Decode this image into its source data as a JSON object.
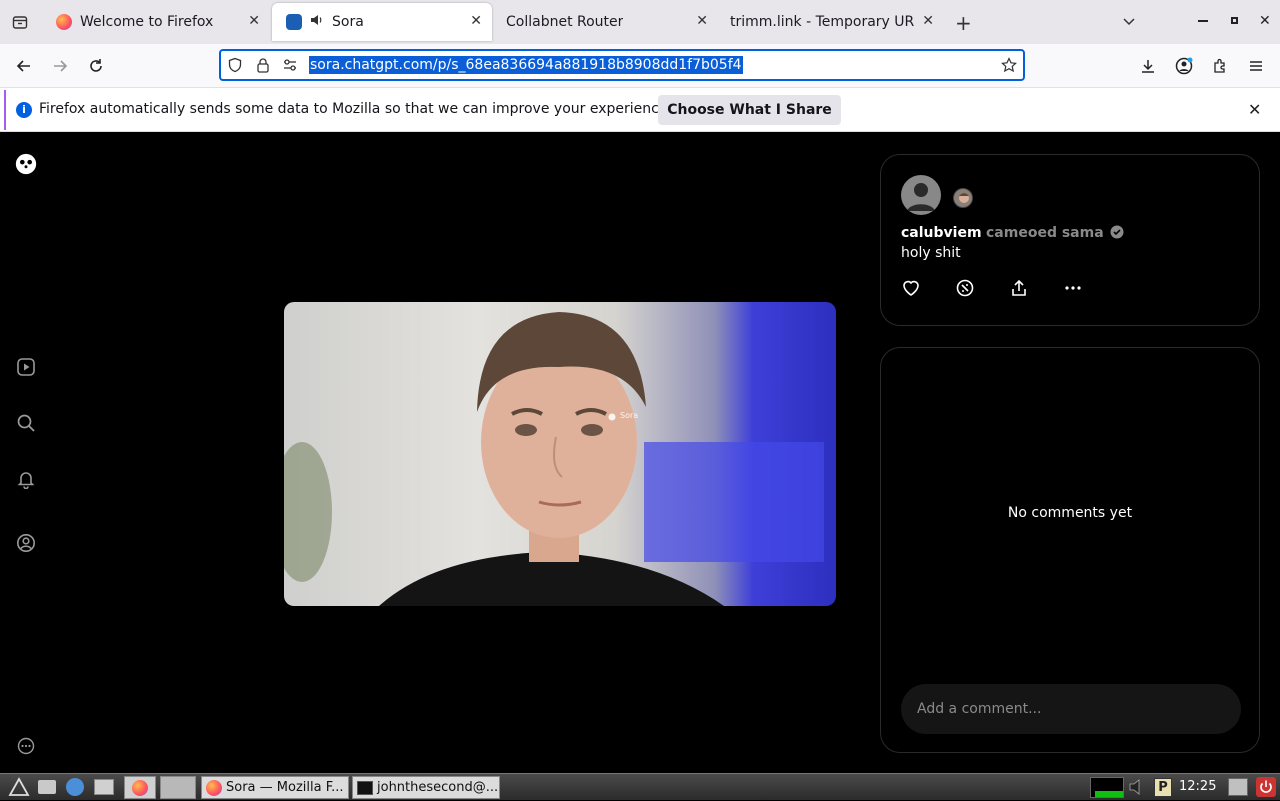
{
  "browser": {
    "tabs": [
      {
        "label": "Welcome to Firefox"
      },
      {
        "label": "Sora"
      },
      {
        "label": "Collabnet Router"
      },
      {
        "label": "trimm.link - Temporary URL"
      }
    ],
    "url": "sora.chatgpt.com/p/s_68ea836694a881918b8908dd1f7b05f4"
  },
  "notification": {
    "text": "Firefox automatically sends some data to Mozilla so that we can improve your experience.",
    "button": "Choose What I Share"
  },
  "post": {
    "author": "calubviem",
    "verb": "cameoed sama",
    "caption": "holy shit",
    "video_watermark": "Sora"
  },
  "comments": {
    "empty": "No comments yet",
    "placeholder": "Add a comment..."
  },
  "taskbar": {
    "tasks": [
      {
        "label": "Sora — Mozilla F..."
      },
      {
        "label": "johnthesecond@..."
      }
    ],
    "clock": "12:25"
  },
  "colors": {
    "accent": "#0061e0",
    "selection": "#0a5fd8"
  }
}
